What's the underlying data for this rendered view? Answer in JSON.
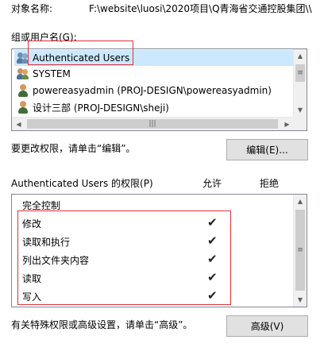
{
  "object": {
    "label": "对象名称:",
    "path": "F:\\website\\luosi\\2020项目\\Q青海省交通控股集团\\\\"
  },
  "groups": {
    "label": "组或用户名(G):",
    "items": [
      {
        "name": "Authenticated Users",
        "icon": "users-group-icon",
        "selected": true
      },
      {
        "name": "SYSTEM",
        "icon": "users-group-icon",
        "selected": false
      },
      {
        "name": "powereasyadmin (PROJ-DESIGN\\powereasyadmin)",
        "icon": "user-icon",
        "selected": false
      },
      {
        "name": "设计三部 (PROJ-DESIGN\\sheji)",
        "icon": "user-icon",
        "selected": false
      }
    ]
  },
  "edit": {
    "hint": "要更改权限，请单击“编辑”。",
    "button": "编辑(E)..."
  },
  "permissions": {
    "title": "Authenticated Users 的权限(P)",
    "col_allow": "允许",
    "col_deny": "拒绝",
    "items": [
      {
        "name": "完全控制",
        "allow": false,
        "deny": false
      },
      {
        "name": "修改",
        "allow": true,
        "deny": false
      },
      {
        "name": "读取和执行",
        "allow": true,
        "deny": false
      },
      {
        "name": "列出文件夹内容",
        "allow": true,
        "deny": false
      },
      {
        "name": "读取",
        "allow": true,
        "deny": false
      },
      {
        "name": "写入",
        "allow": true,
        "deny": false
      }
    ],
    "check_glyph": "✔"
  },
  "advanced": {
    "hint": "有关特殊权限或高级设置，请单击“高级”。",
    "button": "高级(V)"
  },
  "colors": {
    "selection": "#cce8ff",
    "highlight_border": "#e0303a",
    "button_bg": "#e1e1e1"
  }
}
